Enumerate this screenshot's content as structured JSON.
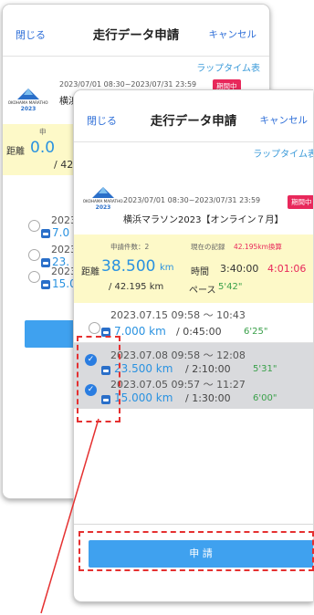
{
  "header": {
    "close": "閉じる",
    "title": "走行データ申請",
    "cancel": "キャンセル"
  },
  "lap_time_link": "ラップタイム表",
  "event": {
    "logo_text": "YOKOHAMA MARATHON 2023",
    "period": "2023/07/01 08:30~2023/07/31 23:59",
    "status": "期間中",
    "name": "横浜マラソン2023【オンライン７月】"
  },
  "summary": {
    "count": "申請件数：2",
    "record_label": "現在の記録",
    "record_note": "42.195km換算",
    "distance_label": "距離",
    "distance_value": "38.500",
    "distance_unit": "km",
    "time_label": "時間",
    "time_value": "3:40:00",
    "converted_time": "4:01:06",
    "target": "/ 42.195 km",
    "pace_label": "ペース",
    "pace_value": "5'42\""
  },
  "back_partial": {
    "distance_value": "0.0",
    "target": "/ 42",
    "count_fragment": "申",
    "row_dates": [
      "2023.",
      "2023.",
      "2023."
    ],
    "row_dists": [
      "7.0",
      "23.",
      "15.0"
    ]
  },
  "runs": [
    {
      "date": "2023.07.15  09:58 ～ 10:43",
      "distance": "7.000 km",
      "time": "/ 0:45:00",
      "pace": "6'25\"",
      "selected": false
    },
    {
      "date": "2023.07.08  09:58 ～ 12:08",
      "distance": "23.500 km",
      "time": "/ 2:10:00",
      "pace": "5'31\"",
      "selected": true
    },
    {
      "date": "2023.07.05  09:57 ～ 11:27",
      "distance": "15.000 km",
      "time": "/ 1:30:00",
      "pace": "6'00\"",
      "selected": true
    }
  ],
  "apply_button": "申 請",
  "colors": {
    "accent": "#2a92e0",
    "badge": "#e8285b",
    "summary_bg": "#fdf9c8",
    "highlight": "#e53030",
    "apply": "#3fa1ef"
  }
}
